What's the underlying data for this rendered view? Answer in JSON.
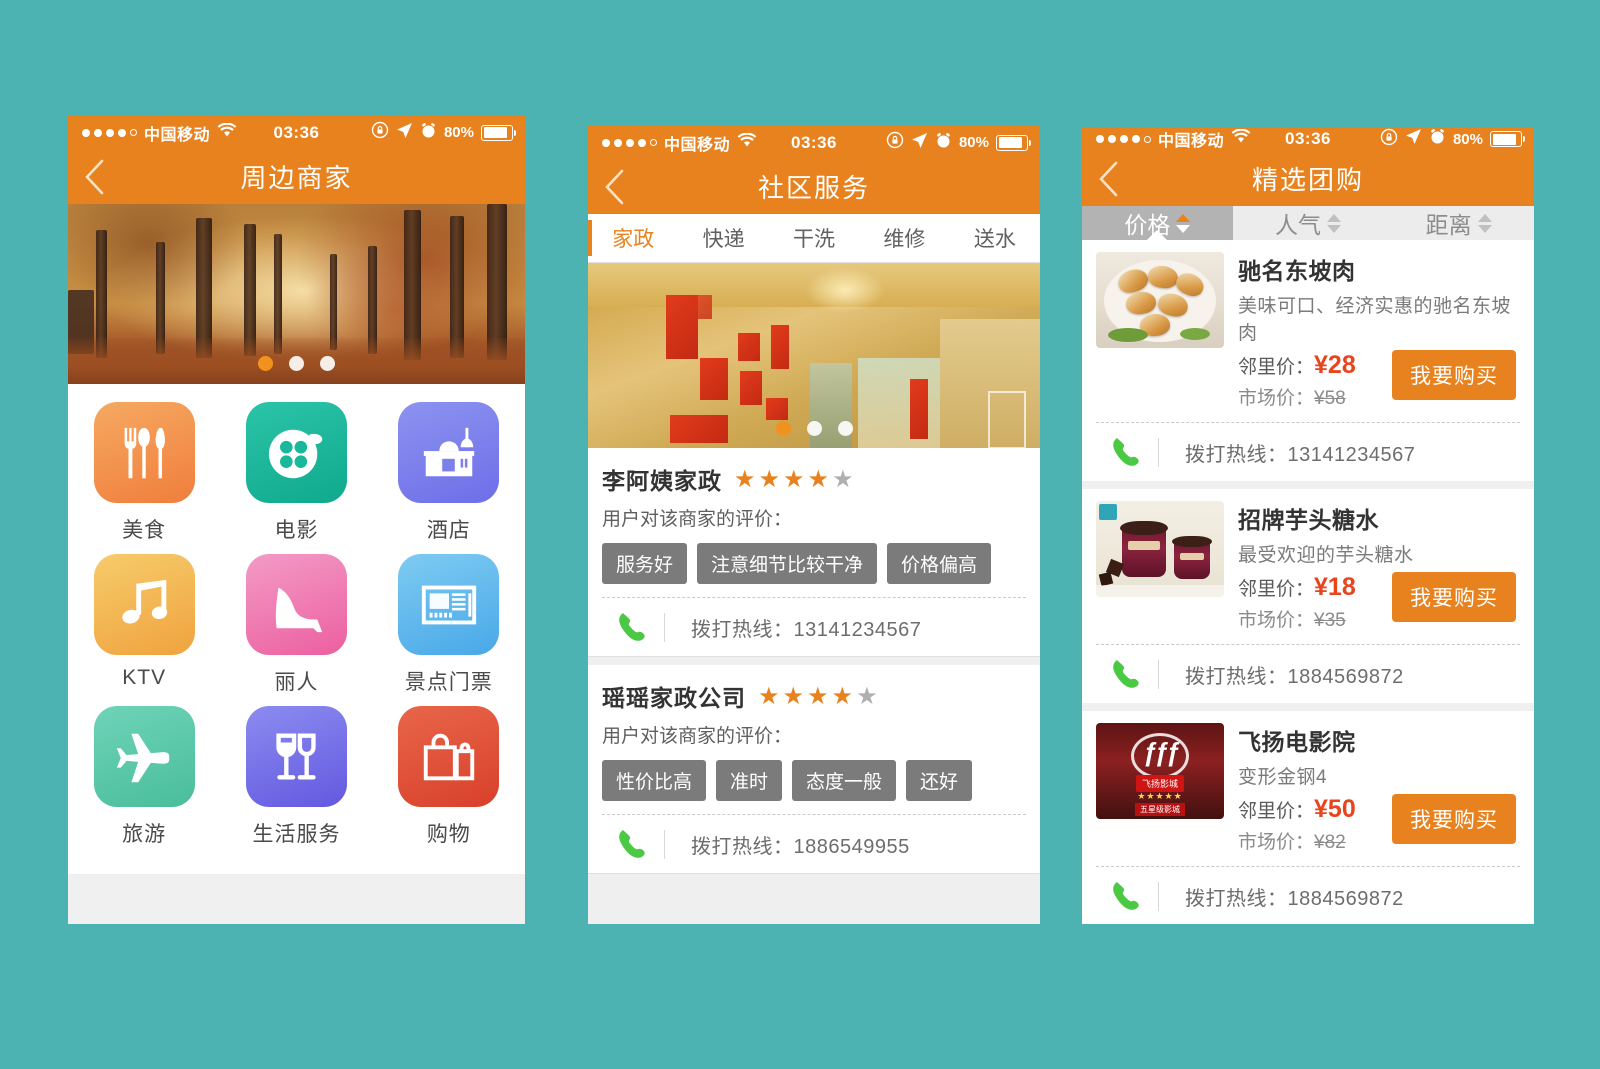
{
  "theme": {
    "accent": "#E8821E",
    "background": "#4CB3B2",
    "price_red": "#E8441E",
    "chip_gray": "#7b7b7b",
    "phone_green": "#4CC944"
  },
  "status_bar": {
    "carrier": "中国移动",
    "time": "03:36",
    "battery_percent": "80%",
    "icons": [
      "signal-dots",
      "wifi-icon",
      "rotation-lock-icon",
      "location-arrow-icon",
      "alarm-clock-icon",
      "battery-icon"
    ]
  },
  "screen1": {
    "title": "周边商家",
    "back_label": "‹",
    "carousel": {
      "active_index": 0,
      "count": 3,
      "image_alt": "autumn-tree-avenue"
    },
    "grid": [
      {
        "label": "美食",
        "icon": "cutlery-icon",
        "color_start": "#F5A962",
        "color_end": "#F07E3C"
      },
      {
        "label": "电影",
        "icon": "film-reel-icon",
        "color_start": "#2BC4A8",
        "color_end": "#0FA98E"
      },
      {
        "label": "酒店",
        "icon": "hotel-building-icon",
        "color_start": "#8C93F0",
        "color_end": "#6E6EE8"
      },
      {
        "label": "KTV",
        "icon": "music-note-icon",
        "color_start": "#F7CB6B",
        "color_end": "#EFA33E"
      },
      {
        "label": "丽人",
        "icon": "high-heel-icon",
        "color_start": "#F39BC6",
        "color_end": "#EC5FA0"
      },
      {
        "label": "景点门票",
        "icon": "ticket-icon",
        "color_start": "#7ECBF2",
        "color_end": "#49A8E8"
      },
      {
        "label": "旅游",
        "icon": "airplane-icon",
        "color_start": "#6FD3B8",
        "color_end": "#49BE9B"
      },
      {
        "label": "生活服务",
        "icon": "wine-glasses-icon",
        "color_start": "#8C8CF0",
        "color_end": "#6358E0"
      },
      {
        "label": "购物",
        "icon": "shopping-bag-icon",
        "color_start": "#E8664A",
        "color_end": "#D8402B"
      }
    ]
  },
  "screen2": {
    "title": "社区服务",
    "back_label": "‹",
    "tabs": [
      {
        "label": "家政",
        "active": true
      },
      {
        "label": "快递",
        "active": false
      },
      {
        "label": "干洗",
        "active": false
      },
      {
        "label": "维修",
        "active": false
      },
      {
        "label": "送水",
        "active": false
      }
    ],
    "carousel": {
      "active_index": 0,
      "count": 3,
      "image_alt": "interior-gold-wall-red-alcoves"
    },
    "review_label": "用户对该商家的评价：",
    "call_label": "拨打热线：",
    "merchants": [
      {
        "name": "李阿姨家政",
        "rating": 4,
        "max_rating": 5,
        "tags": [
          "服务好",
          "注意细节比较干净",
          "价格偏高"
        ],
        "phone": "13141234567"
      },
      {
        "name": "瑶瑶家政公司",
        "rating": 4,
        "max_rating": 5,
        "tags": [
          "性价比高",
          "准时",
          "态度一般",
          "还好"
        ],
        "phone": "1886549955"
      }
    ]
  },
  "screen3": {
    "title": "精选团购",
    "back_label": "‹",
    "sort_tabs": [
      {
        "label": "价格",
        "active": true
      },
      {
        "label": "人气",
        "active": false
      },
      {
        "label": "距离",
        "active": false
      }
    ],
    "neighbor_price_label": "邻里价：",
    "market_price_label": "市场价：",
    "buy_label": "我要购买",
    "call_label": "拨打热线：",
    "deals": [
      {
        "title": "驰名东坡肉",
        "desc": "美味可口、经济实惠的驰名东坡肉",
        "price": "¥28",
        "market_price": "¥58",
        "phone": "13141234567",
        "image_alt": "dongpo-pork-dish"
      },
      {
        "title": "招牌芋头糖水",
        "desc": "最受欢迎的芋头糖水",
        "price": "¥18",
        "market_price": "¥35",
        "phone": "1884569872",
        "image_alt": "haagen-dazs-ice-cream"
      },
      {
        "title": "飞扬电影院",
        "desc": "变形金钢4",
        "price": "¥50",
        "market_price": "¥82",
        "phone": "1884569872",
        "image_alt": "feiyang-cinema-logo"
      }
    ]
  }
}
